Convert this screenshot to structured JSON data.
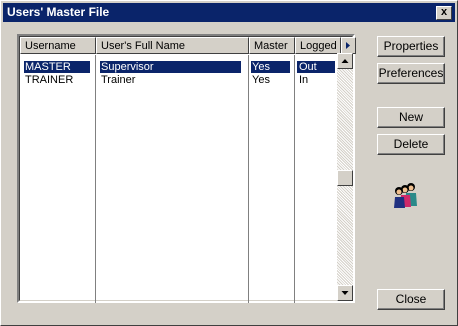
{
  "window": {
    "title": "Users' Master File",
    "close_glyph": "x"
  },
  "list": {
    "columns": [
      "Username",
      "User's Full Name",
      "Master",
      "Logged"
    ],
    "rows": [
      {
        "username": "MASTER",
        "full_name": "Supervisor",
        "master": "Yes",
        "logged": "Out",
        "selected": true
      },
      {
        "username": "TRAINER",
        "full_name": "Trainer",
        "master": "Yes",
        "logged": "In",
        "selected": false
      }
    ]
  },
  "buttons": {
    "properties": "Properties",
    "preferences": "Preferences",
    "new": "New",
    "delete": "Delete",
    "close": "Close"
  },
  "colors": {
    "titlebar": "#0a246a",
    "selection": "#0a246a",
    "face": "#d4d0c8"
  },
  "icons": [
    "close-icon",
    "scroll-right-icon",
    "scroll-up-icon",
    "scroll-down-icon",
    "users-group-icon"
  ]
}
